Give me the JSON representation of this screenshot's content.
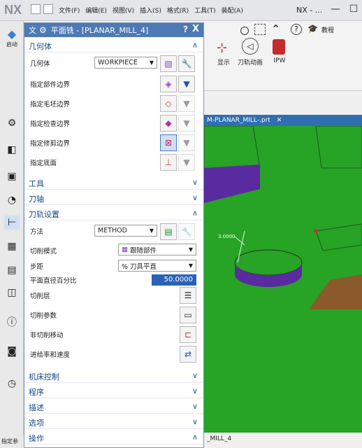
{
  "app": {
    "logo": "NX",
    "title": "NX - ...",
    "menus": [
      "文件(F)",
      "编辑(E)",
      "视图(V)",
      "插入(S)",
      "格式(R)",
      "工具(T)",
      "装配(A)"
    ],
    "tutorial": "教程"
  },
  "ribbon": {
    "buttons": [
      {
        "label": "显示"
      },
      {
        "label": "刀轨动画"
      },
      {
        "label": "IPW"
      }
    ],
    "left_label": "启动"
  },
  "viewport": {
    "tab_label": "M-PLANAR_MILL-.prt",
    "bottom_label": "_MILL_4",
    "dim_label": "3.0000"
  },
  "dialog": {
    "prefix": "文",
    "title": "平面铣 - [PLANAR_MILL_4]",
    "help": "?",
    "close": "X",
    "sections": {
      "geometry": "几何体",
      "tool": "工具",
      "axis": "刀轴",
      "path_settings": "刀轨设置",
      "machine_control": "机床控制",
      "program": "程序",
      "description": "描述",
      "options": "选项",
      "actions": "操作"
    },
    "geometry_rows": {
      "geometry_label": "几何体",
      "geometry_value": "WORKPIECE",
      "part_boundary": "指定部件边界",
      "blank_boundary": "指定毛坯边界",
      "check_boundary": "指定检查边界",
      "trim_boundary": "指定修剪边界",
      "floor": "指定底面"
    },
    "path_rows": {
      "method_label": "方法",
      "method_value": "METHOD",
      "cut_pattern_label": "切削模式",
      "cut_pattern_value": "跟随部件",
      "stepover_label": "步距",
      "stepover_value": "% 刀具平直",
      "percent_label": "平面直径百分比",
      "percent_value": "50.0000",
      "cut_levels": "切削层",
      "cut_params": "切削参数",
      "non_cut_moves": "非切削移动",
      "feeds_speeds": "进给率和速度"
    }
  },
  "status": {
    "left": "指定参"
  },
  "colors": {
    "title_bar": "#4d79b4",
    "section_text": "#1a4a8a",
    "viewport_green": "#27a326",
    "part_purple": "#5a2aa0",
    "selected_input": "#2a62b8"
  }
}
